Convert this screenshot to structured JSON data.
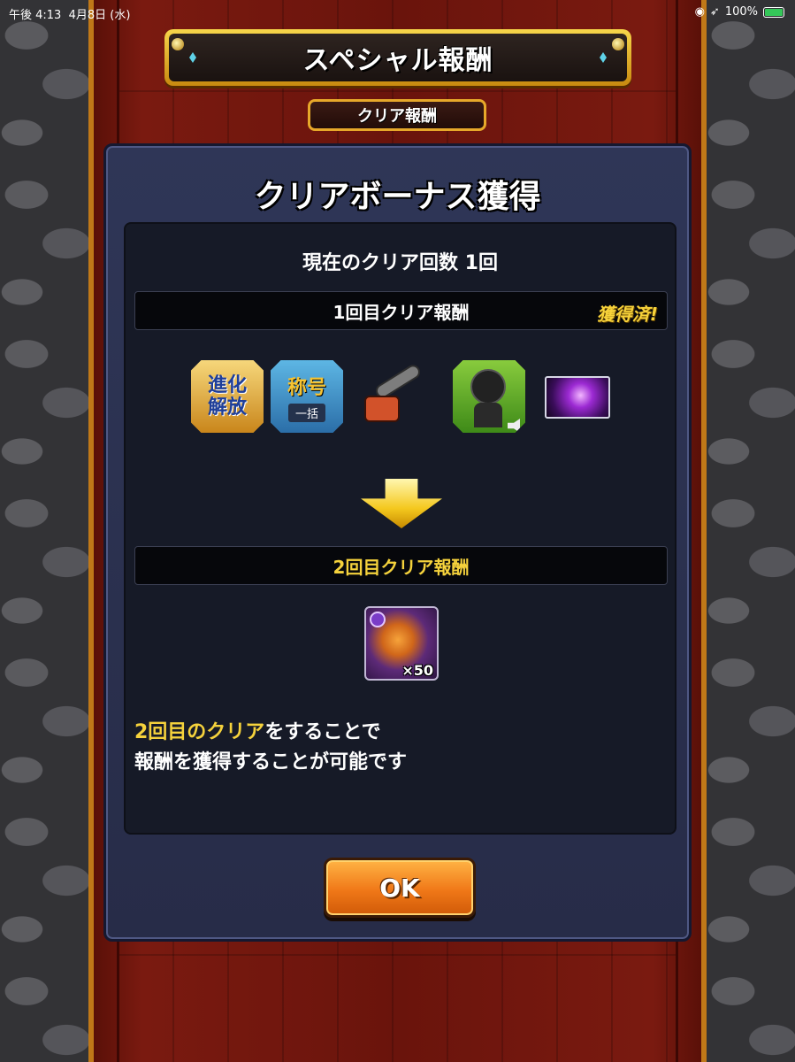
{
  "status_bar": {
    "time": "午後 4:13",
    "date": "4月8日 (水)",
    "battery": "100%"
  },
  "header": {
    "title": "スペシャル報酬",
    "tab_label": "クリア報酬"
  },
  "modal": {
    "title": "クリアボーナス獲得",
    "clear_count": "現在のクリア回数 1回",
    "first_reward": {
      "label": "1回目クリア報酬",
      "status": "獲得済!",
      "items": [
        {
          "icon": "evolution-unlock-icon",
          "line1": "進化",
          "line2": "解放"
        },
        {
          "icon": "title-icon",
          "line1": "称号",
          "line2": "一括"
        },
        {
          "icon": "chainsaw-item-icon"
        },
        {
          "icon": "character-voice-icon"
        },
        {
          "icon": "card-art-icon"
        }
      ]
    },
    "second_reward": {
      "label": "2回目クリア報酬",
      "item": {
        "icon": "chainsaw-man-character-icon",
        "quantity": "×50"
      }
    },
    "description": {
      "highlight": "2回目のクリア",
      "line1_rest": "をすることで",
      "line2": "報酬を獲得することが可能です"
    },
    "ok_label": "OK"
  },
  "colors": {
    "accent_yellow": "#f5d23c",
    "button_orange": "#f07818",
    "modal_bg": "#2f3657",
    "hall_red": "#6a140c"
  }
}
